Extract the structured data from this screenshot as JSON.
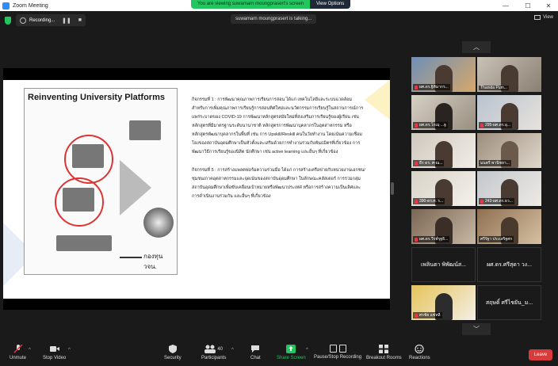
{
  "window": {
    "title": "Zoom Meeting",
    "minimize": "—",
    "maximize": "☐",
    "close": "✕"
  },
  "share_banner": {
    "message": "You are viewing suwamarn moungprasert's screen",
    "view_options": "View Options"
  },
  "recording": {
    "label": "Recording...",
    "pause": "❚❚",
    "stop": "■"
  },
  "talking": "suwamarn moungprasert is talking...",
  "view_button": "View",
  "slide": {
    "left_title": "Reinventing University Platforms",
    "left_caption": "กองทุน วจน.",
    "right_para_1": "กิจกรรมที่ 1 : การพัฒนาคุณภาพการเรียนการสอน ได้แก่ เทคโนโลยีและระบบแวดล้อม สำหรับการเพิ่มคุณภาพการเรียนรู้การสอนทิศใหม่และนวัตกรรมการเรียนรู้ในสถานการณ์การแพร่ระบาดของ COVID-19 การพัฒนาหลักสูตรสมัยใหม่ที่ส่งเสริมการเรียนรู้ของผู้เรียน เช่น หลักสูตรที่มีมาตรฐานระดับนานาชาติ หลักสูตรการพัฒนาบุคลากรในอุตสาหกรรม หรือหลักสูตรพัฒนาบุคลากรในพื้นที่ เช่น การ Upskill/Reskill คนในวัยทำงาน โดยเน้นความเชื่อมโยงของสถาบันอุดมศึกษาเป็นหัวตั้งและเสริมด้วยการทำงานร่วมกับพันธมิตรที่เกี่ยวข้อง การพัฒนาวิธีการเรียนรู้ของนิสิต นักศึกษา เช่น active learning และอื่นๆ ที่เกี่ยวข้อง",
    "right_para_2": "กิจกรรมที่ 5 : การสร้างแพลตฟอร์มความร่วมมือ ได้แก่ การสร้างเครือข่ายกับหน่วยงานเอกชน/ชุมชน/ภาคอุตสาหกรรมและจุดเน้นของสถาบันอุดมศึกษา ในลักษณะคลัสเตอร์ การรวมกลุ่มสถาบันอุดมศึกษาเพื่อขับเคลื่อนเป้าหมายหรือพัฒนาประเทศ หรือการสร้างความเป็นเลิศและการดำเนินงานร่วมกัน และอื่นๆ ที่เกี่ยวข้อง"
  },
  "gallery": {
    "scroll_up": "︿",
    "scroll_down": "﹀",
    "tiles": [
      {
        "name": "ผศ.ดร.ฐิติมากร..."
      },
      {
        "name": "Thanida Pum..."
      },
      {
        "name": "ผศ.ดร.โกเมฺ ...ฐ"
      },
      {
        "name": "295-ผศ.ดร.อุ..."
      },
      {
        "name": "ธีร ดร. ศ-ณ..."
      },
      {
        "name": "มนตรี พานิชยา..."
      },
      {
        "name": "390-ดร.ศ. ร..."
      },
      {
        "name": "243-ผศ.ดร.ธว..."
      },
      {
        "name": "ผศ.ดร.วีรพ์รุฐธิ..."
      },
      {
        "name": "ศรีรัฐา ประเสริฐศก"
      },
      {
        "name": "ศรชัย แซ่หลี"
      }
    ],
    "text_tiles": [
      "เพลินตา พิพัฒน์ส...",
      "ผศ.ดร.ศรีสุดา วง...",
      "สฤษดิ์ ศรีไชยัน_ม..."
    ]
  },
  "toolbar": {
    "unmute": "Unmute",
    "stop_video": "Stop Video",
    "security": "Security",
    "participants": "Participants",
    "participants_count": "40",
    "chat": "Chat",
    "share_screen": "Share Screen",
    "pause_recording": "Pause/Stop Recording",
    "breakout": "Breakout Rooms",
    "reactions": "Reactions",
    "leave": "Leave"
  }
}
